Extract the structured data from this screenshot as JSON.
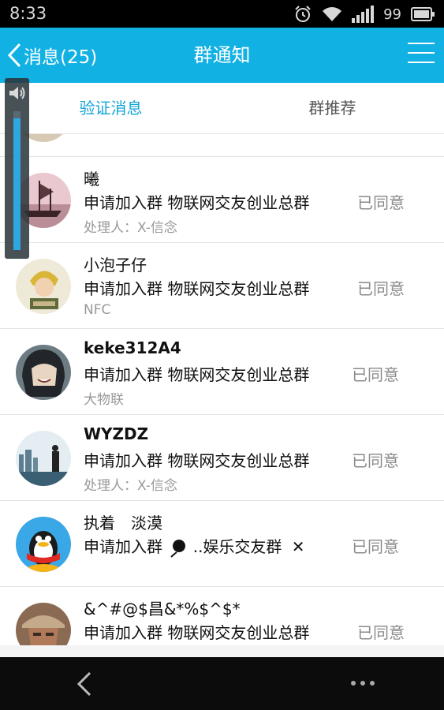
{
  "status_bar": {
    "time": "8:33",
    "battery": "99"
  },
  "header": {
    "back_label": "消息(25)",
    "title": "群通知"
  },
  "tabs": [
    {
      "label": "验证消息",
      "active": true
    },
    {
      "label": "群推荐",
      "active": false
    }
  ],
  "volume": {
    "level": 0.95
  },
  "requests": [
    {
      "name": "曦",
      "request": "申请加入群 物联网交友创业总群",
      "handler": "处理人：X-信念",
      "status": "已同意",
      "avatar": "pirate-ship-avatar"
    },
    {
      "name": "小泡子仔",
      "request": "申请加入群 物联网交友创业总群",
      "handler": "NFC",
      "status": "已同意",
      "avatar": "anime-character-avatar"
    },
    {
      "name": "keke312A4",
      "request": "申请加入群 物联网交友创业总群",
      "handler": "大物联",
      "status": "已同意",
      "avatar": "anime-girl-avatar"
    },
    {
      "name": "WYZDZ",
      "request": "申请加入群 物联网交友创业总群",
      "handler": "处理人：X-信念",
      "status": "已同意",
      "avatar": "city-skyline-avatar"
    },
    {
      "name": "执着　淡漠",
      "request_prefix": "申请加入群",
      "request_suffix": "..娱乐交友群",
      "handler": "",
      "status": "已同意",
      "avatar": "qq-penguin-avatar"
    },
    {
      "name": "&^#@$昌&*%$^$*",
      "request": "申请加入群 物联网交友创业总群",
      "handler": "",
      "status": "已同意",
      "avatar": "man-in-cap-avatar"
    }
  ],
  "colors": {
    "accent": "#12b1e4",
    "status_gray": "#8a8a8a"
  }
}
